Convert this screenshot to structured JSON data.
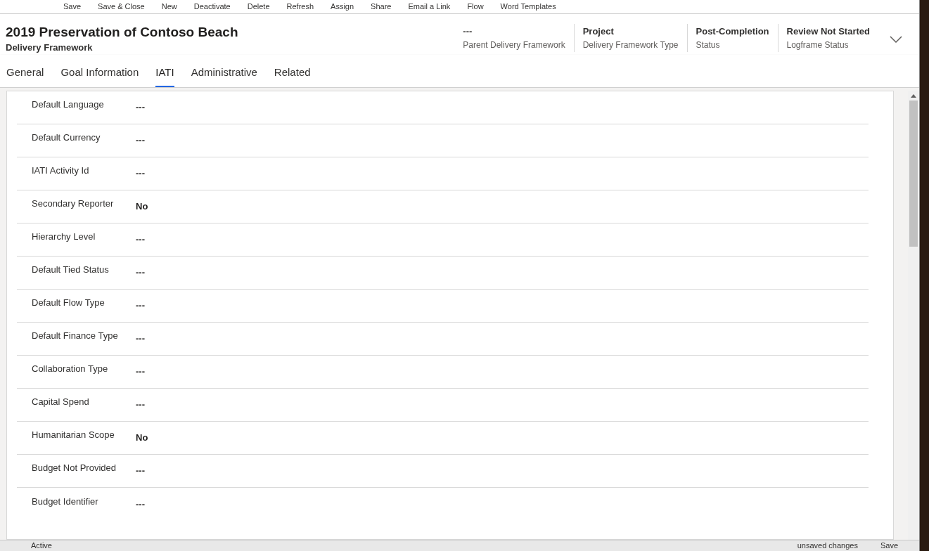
{
  "toolbar": [
    "Save",
    "Save & Close",
    "New",
    "Deactivate",
    "Delete",
    "Refresh",
    "Assign",
    "Share",
    "Email a Link",
    "Flow",
    "Word Templates"
  ],
  "record": {
    "title": "2019 Preservation of Contoso Beach",
    "entity": "Delivery Framework"
  },
  "header_fields": [
    {
      "value": "---",
      "label": "Parent Delivery Framework"
    },
    {
      "value": "Project",
      "label": "Delivery Framework Type"
    },
    {
      "value": "Post-Completion",
      "label": "Status"
    },
    {
      "value": "Review Not Started",
      "label": "Logframe Status"
    }
  ],
  "tabs": [
    {
      "label": "General",
      "selected": false
    },
    {
      "label": "Goal Information",
      "selected": false
    },
    {
      "label": "IATI",
      "selected": true
    },
    {
      "label": "Administrative",
      "selected": false
    },
    {
      "label": "Related",
      "selected": false
    }
  ],
  "fields": [
    {
      "label": "Default Language",
      "value": "---"
    },
    {
      "label": "Default Currency",
      "value": "---"
    },
    {
      "label": "IATI Activity Id",
      "value": "---"
    },
    {
      "label": "Secondary Reporter",
      "value": "No"
    },
    {
      "label": "Hierarchy Level",
      "value": "---"
    },
    {
      "label": "Default Tied Status",
      "value": "---"
    },
    {
      "label": "Default Flow Type",
      "value": "---"
    },
    {
      "label": "Default Finance Type",
      "value": "---"
    },
    {
      "label": "Collaboration Type",
      "value": "---"
    },
    {
      "label": "Capital Spend",
      "value": "---"
    },
    {
      "label": "Humanitarian Scope",
      "value": "No"
    },
    {
      "label": "Budget Not Provided",
      "value": "---"
    },
    {
      "label": "Budget Identifier",
      "value": "---"
    }
  ],
  "status_bar": {
    "state": "Active",
    "changes": "unsaved changes",
    "save": "Save"
  }
}
